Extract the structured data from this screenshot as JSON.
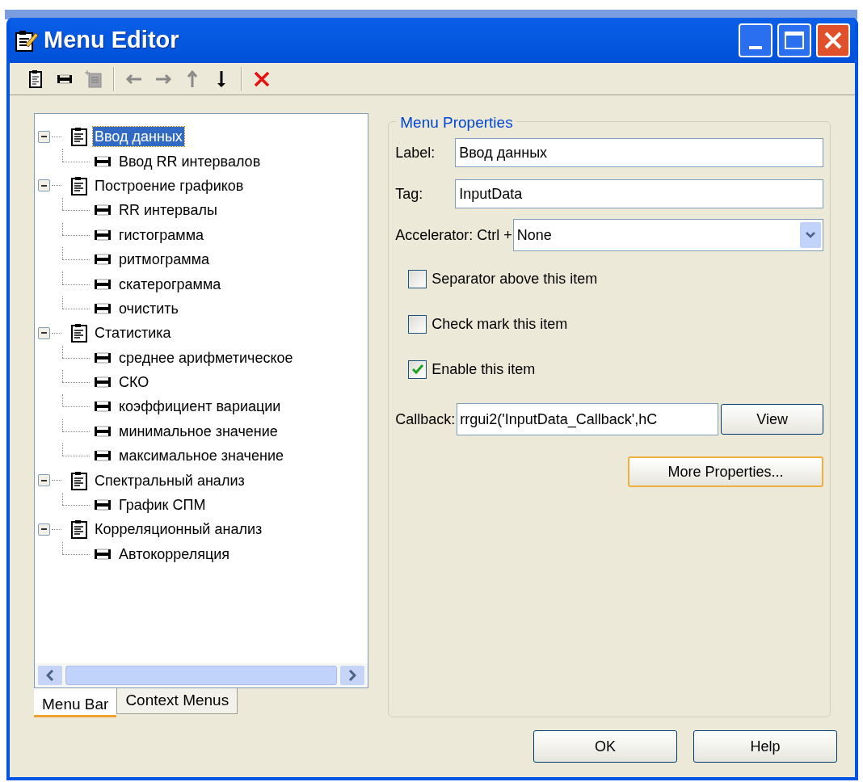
{
  "window": {
    "title": "Menu Editor"
  },
  "toolbar": [
    {
      "kind": "new-menu",
      "disabled": false
    },
    {
      "kind": "new-item",
      "disabled": false
    },
    {
      "kind": "new-context",
      "disabled": true
    },
    {
      "kind": "separator"
    },
    {
      "kind": "left",
      "disabled": true
    },
    {
      "kind": "right",
      "disabled": true
    },
    {
      "kind": "up",
      "disabled": true
    },
    {
      "kind": "down",
      "disabled": false
    },
    {
      "kind": "separator"
    },
    {
      "kind": "delete",
      "disabled": false
    }
  ],
  "tree": [
    {
      "label": "Ввод данных",
      "kind": "menu",
      "expanded": true,
      "selected": true,
      "children": [
        {
          "label": "Ввод RR интервалов",
          "kind": "item",
          "selected": false
        }
      ]
    },
    {
      "label": "Построение графиков",
      "kind": "menu",
      "expanded": true,
      "selected": false,
      "children": [
        {
          "label": "RR интервалы",
          "kind": "item",
          "selected": false
        },
        {
          "label": "гистограмма",
          "kind": "item",
          "selected": false
        },
        {
          "label": "ритмограмма",
          "kind": "item",
          "selected": false
        },
        {
          "label": "скатерограмма",
          "kind": "item",
          "selected": false
        },
        {
          "label": "очистить",
          "kind": "item",
          "selected": false
        }
      ]
    },
    {
      "label": "Статистика",
      "kind": "menu",
      "expanded": true,
      "selected": false,
      "children": [
        {
          "label": "среднее арифметическое",
          "kind": "item",
          "selected": false
        },
        {
          "label": "СКО",
          "kind": "item",
          "selected": false
        },
        {
          "label": "коэффициент вариации",
          "kind": "item",
          "selected": false
        },
        {
          "label": "минимальное значение",
          "kind": "item",
          "selected": false
        },
        {
          "label": "максимальное значение",
          "kind": "item",
          "selected": false
        }
      ]
    },
    {
      "label": "Спектральный анализ",
      "kind": "menu",
      "expanded": true,
      "selected": false,
      "children": [
        {
          "label": "График СПМ",
          "kind": "item",
          "selected": false
        }
      ]
    },
    {
      "label": "Корреляционный анализ",
      "kind": "menu",
      "expanded": true,
      "selected": false,
      "children": [
        {
          "label": "Автокорреляция",
          "kind": "item",
          "selected": false
        }
      ]
    }
  ],
  "tabs": [
    {
      "label": "Menu Bar",
      "selected": true
    },
    {
      "label": "Context Menus",
      "selected": false
    }
  ],
  "properties": {
    "title": "Menu Properties",
    "label": {
      "caption": "Label:",
      "value": "Ввод данных"
    },
    "tag": {
      "caption": "Tag:",
      "value": "InputData"
    },
    "accelerator": {
      "caption": "Accelerator: Ctrl +",
      "value": "None"
    },
    "checkboxes": [
      {
        "label": "Separator above this item",
        "checked": false
      },
      {
        "label": "Check mark this item",
        "checked": false
      },
      {
        "label": "Enable this item",
        "checked": true
      }
    ],
    "callback": {
      "caption": "Callback:",
      "value": "rrgui2('InputData_Callback',hC",
      "button": "View"
    },
    "more_button": "More Properties..."
  },
  "buttons": [
    "OK",
    "Help"
  ]
}
